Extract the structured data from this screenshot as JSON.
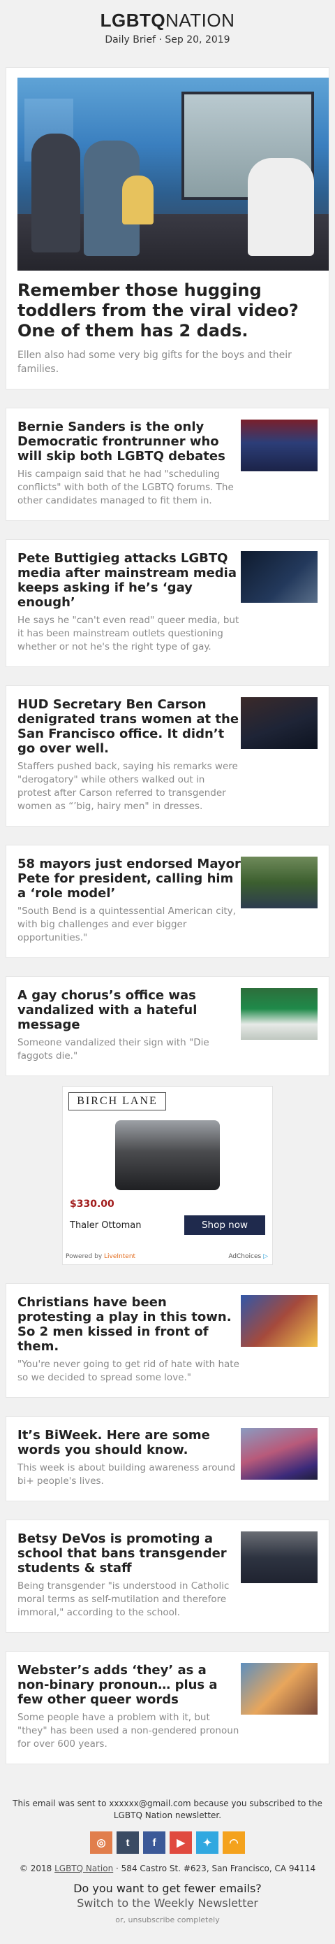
{
  "header": {
    "logo_bold": "LGBTQ",
    "logo_rest": "NATION",
    "subtitle": "Daily Brief · Sep 20, 2019"
  },
  "hero": {
    "title": "Remember those hugging toddlers from the viral video? One of them has 2 dads.",
    "description": "Ellen also had some very big gifts for the boys and their families."
  },
  "articles": [
    {
      "title": "Bernie Sanders is the only Democratic frontrunner who will skip both LGBTQ debates",
      "description": "His campaign said that he had \"scheduling conflicts\" with both of the LGBTQ forums. The other candidates managed to fit them in."
    },
    {
      "title": "Pete Buttigieg attacks LGBTQ media after mainstream media keeps asking if he’s ‘gay enough’",
      "description": "He says he \"can't even read\" queer media, but it has been mainstream outlets questioning whether or not he's the right type of gay."
    },
    {
      "title": "HUD Secretary Ben Carson denigrated trans women at the San Francisco office. It didn’t go over well.",
      "description": "Staffers pushed back, saying his remarks were \"derogatory\" while others walked out in protest after Carson referred to transgender women as “’big, hairy men\" in dresses."
    },
    {
      "title": "58 mayors just endorsed Mayor Pete for president, calling him a ‘role model’",
      "description": "\"South Bend is a quintessential American city, with big challenges and ever bigger opportunities.\""
    },
    {
      "title": "A gay chorus’s office was vandalized with a hateful message",
      "description": "Someone vandalized their sign with \"Die faggots die.\""
    },
    {
      "title": "Christians have been protesting a play in this town. So 2 men kissed in front of them.",
      "description": "\"You're never going to get rid of hate with hate so we decided to spread some love.\""
    },
    {
      "title": "It’s BiWeek. Here are some words you should know.",
      "description": "This week is about building awareness around bi+ people's lives."
    },
    {
      "title": "Betsy DeVos is promoting a school that bans transgender students & staff",
      "description": "Being transgender \"is understood in Catholic moral terms as self-mutilation and therefore immoral,\" according to the school."
    },
    {
      "title": "Webster’s adds ‘they’ as a non-binary pronoun… plus a few other queer words",
      "description": "Some people have a problem with it, but \"they\" has been used a non-gendered pronoun for over 600 years."
    }
  ],
  "ad": {
    "brand": "BIRCH LANE",
    "price": "$330.00",
    "product": "Thaler Ottoman",
    "cta": "Shop now",
    "powered_by": "Powered by",
    "liveintent": "LiveIntent",
    "adchoices": "AdChoices"
  },
  "footer": {
    "note": "This email was sent to xxxxxx@gmail.com because you subscribed to the LGBTQ Nation newsletter.",
    "social": [
      "instagram-icon",
      "tumblr-icon",
      "facebook-icon",
      "youtube-icon",
      "twitter-icon",
      "rss-icon"
    ],
    "copyright_prefix": "© 2018",
    "copyright_link": "LGBTQ Nation",
    "address": "· 584 Castro St. #623, San Francisco, CA 94114",
    "question": "Do you want to get fewer emails?",
    "switch_link": "Switch to the Weekly Newsletter",
    "unsubscribe": "or, unsubscribe completely"
  }
}
